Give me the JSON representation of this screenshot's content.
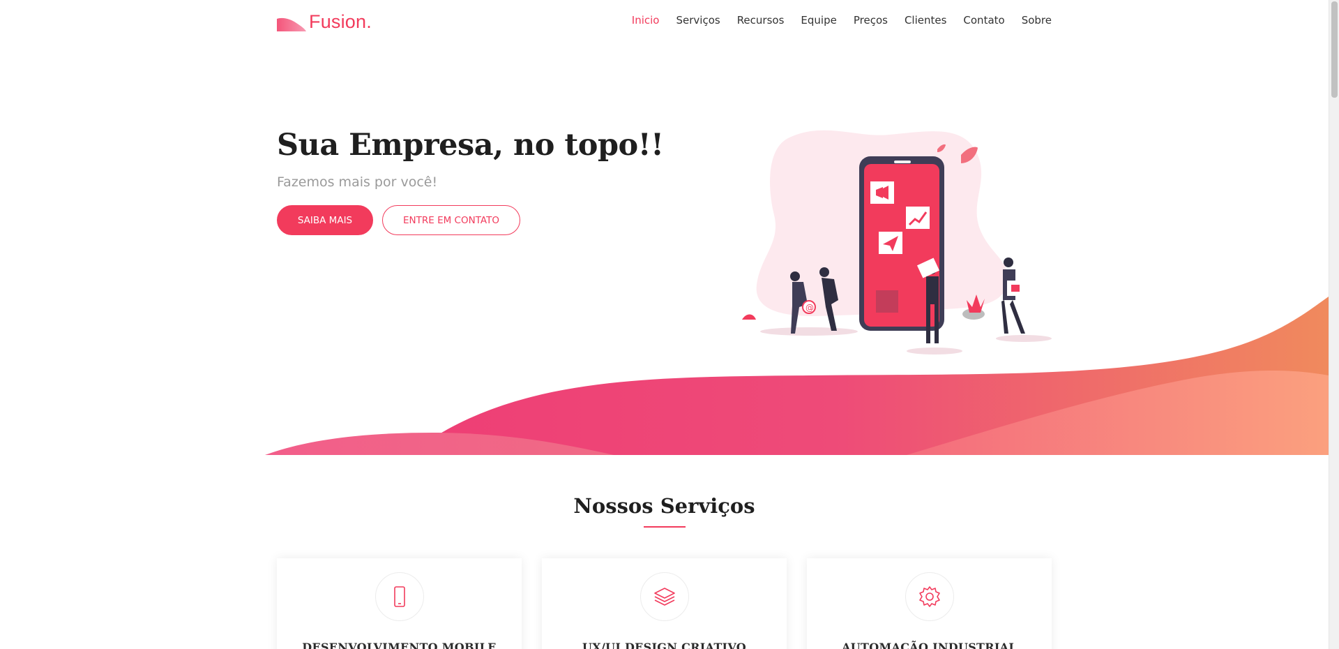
{
  "header": {
    "logo_text": "Fusion.",
    "nav": [
      {
        "label": "Inicio",
        "active": true
      },
      {
        "label": "Serviços",
        "active": false
      },
      {
        "label": "Recursos",
        "active": false
      },
      {
        "label": "Equipe",
        "active": false
      },
      {
        "label": "Preços",
        "active": false
      },
      {
        "label": "Clientes",
        "active": false
      },
      {
        "label": "Contato",
        "active": false
      },
      {
        "label": "Sobre",
        "active": false
      }
    ]
  },
  "hero": {
    "title": "Sua Empresa, no topo!!",
    "subtitle": "Fazemos mais por você!",
    "primary_button": "SAIBA MAIS",
    "secondary_button": "ENTRE EM CONTATO"
  },
  "services": {
    "title": "Nossos Serviços",
    "cards": [
      {
        "icon": "smartphone-icon",
        "title": "DESENVOLVIMENTO MOBILE"
      },
      {
        "icon": "layers-icon",
        "title": "UX/UI DESIGN CRIATIVO"
      },
      {
        "icon": "gear-icon",
        "title": "AUTOMAÇÃO INDUSTRIAL"
      }
    ]
  },
  "colors": {
    "accent": "#f23b5c",
    "wave_start": "#ee3f75",
    "wave_end": "#f08a5d",
    "text_dark": "#1f1f1f",
    "text_muted": "#9a9a9a"
  }
}
